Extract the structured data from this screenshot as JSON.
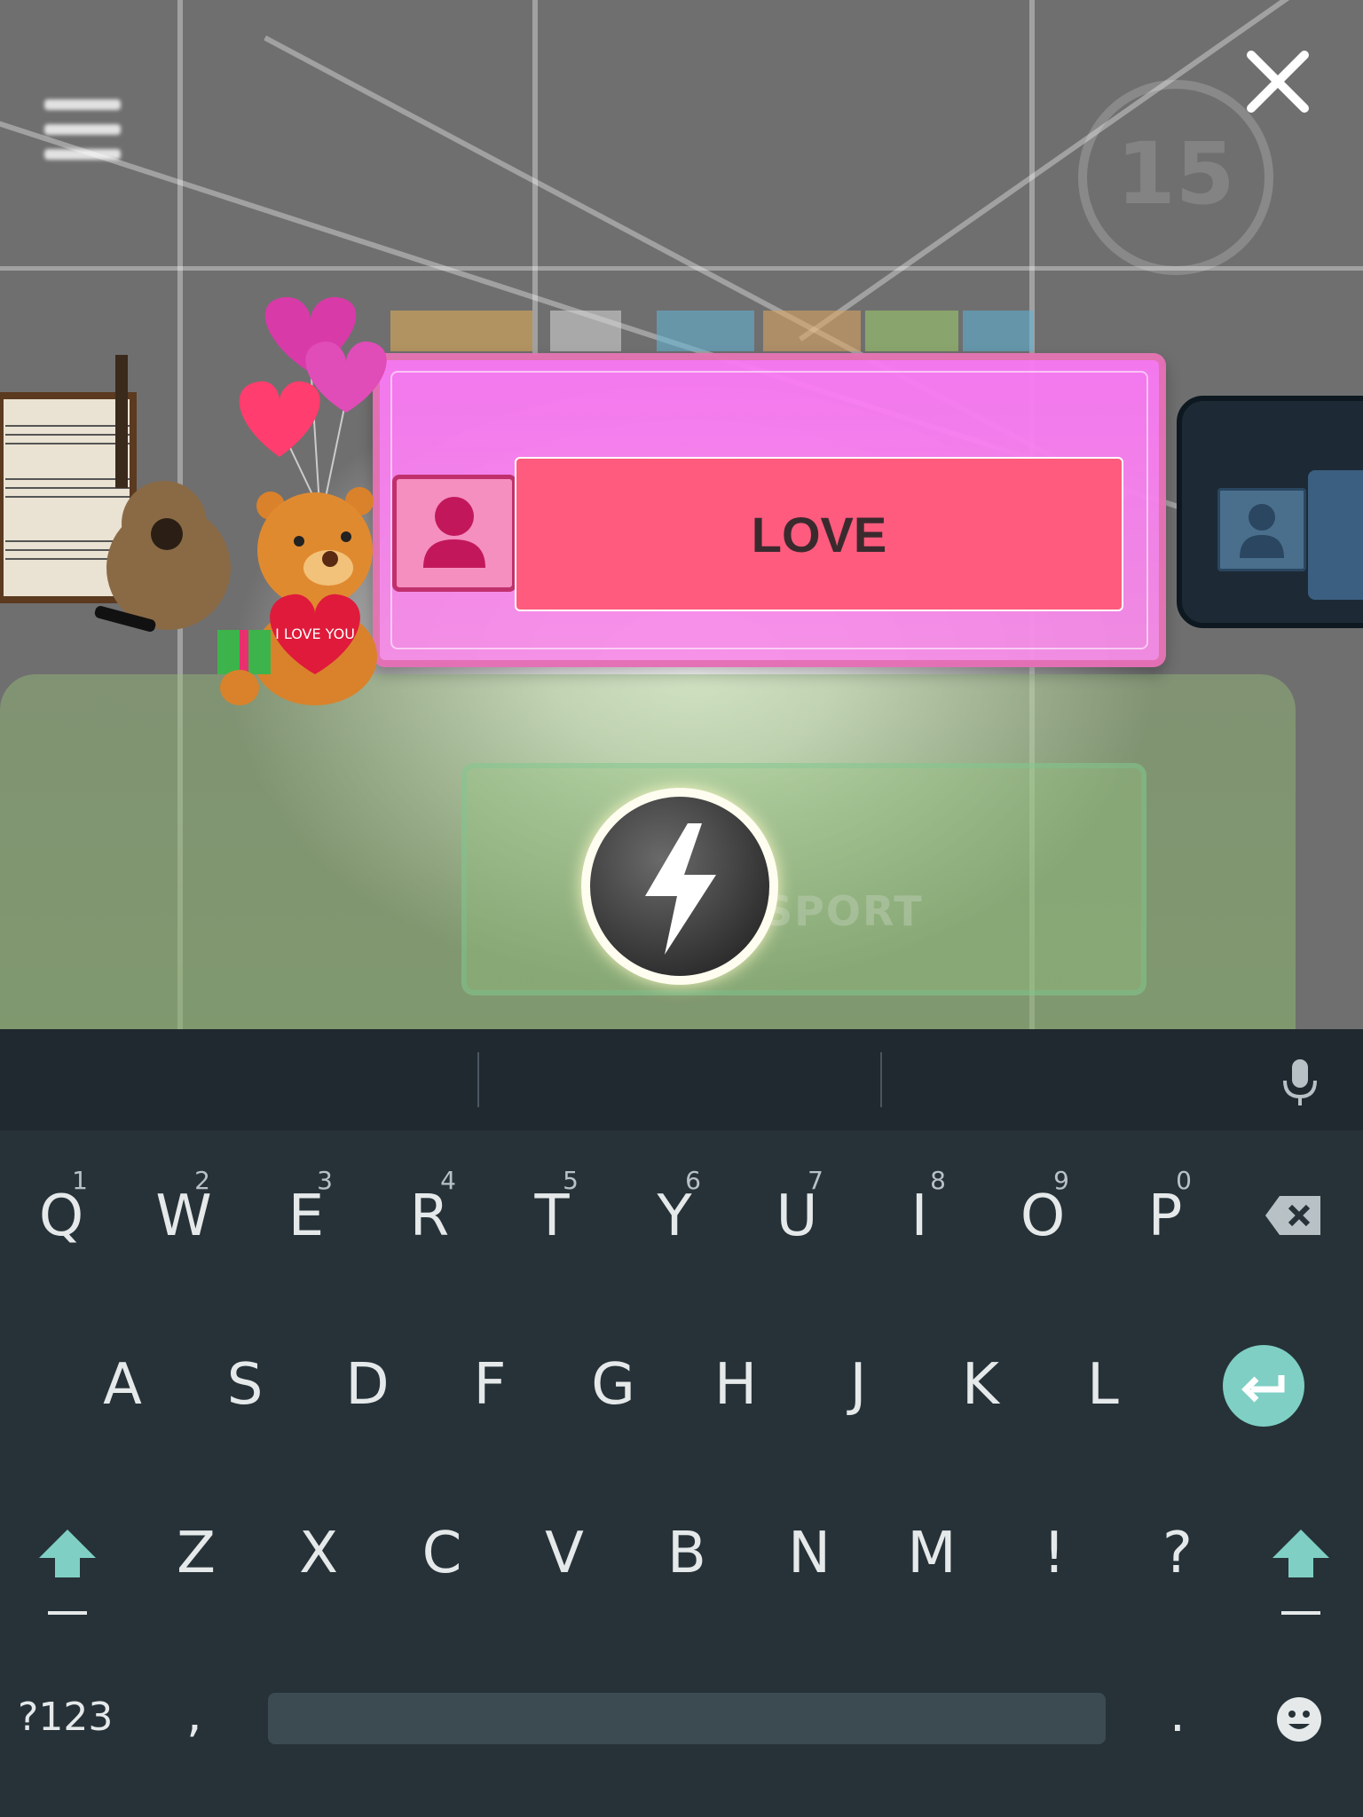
{
  "game": {
    "word": "LOVE",
    "background_label": "SPORT",
    "badge_number": "15"
  },
  "keyboard": {
    "row1": [
      {
        "label": "Q",
        "hint": "1"
      },
      {
        "label": "W",
        "hint": "2"
      },
      {
        "label": "E",
        "hint": "3"
      },
      {
        "label": "R",
        "hint": "4"
      },
      {
        "label": "T",
        "hint": "5"
      },
      {
        "label": "Y",
        "hint": "6"
      },
      {
        "label": "U",
        "hint": "7"
      },
      {
        "label": "I",
        "hint": "8"
      },
      {
        "label": "O",
        "hint": "9"
      },
      {
        "label": "P",
        "hint": "0"
      }
    ],
    "row2": [
      "A",
      "S",
      "D",
      "F",
      "G",
      "H",
      "J",
      "K",
      "L"
    ],
    "row3": [
      "Z",
      "X",
      "C",
      "V",
      "B",
      "N",
      "M",
      "!",
      "?"
    ],
    "symbols_label": "?123",
    "comma": ",",
    "period": "."
  },
  "colors": {
    "card_pink": "#fa78f5",
    "word_box": "#ff5b7e",
    "enter_key": "#7fcfc4",
    "shift_arrow": "#7fcfc4",
    "keyboard_bg": "#263238"
  },
  "icons": {
    "menu": "hamburger-menu-icon",
    "close": "close-x-icon",
    "power": "lightning-bolt-icon",
    "mic": "microphone-icon",
    "backspace": "backspace-icon",
    "enter": "enter-return-icon",
    "shift": "shift-arrow-icon",
    "emoji": "smiley-emoji-icon"
  }
}
